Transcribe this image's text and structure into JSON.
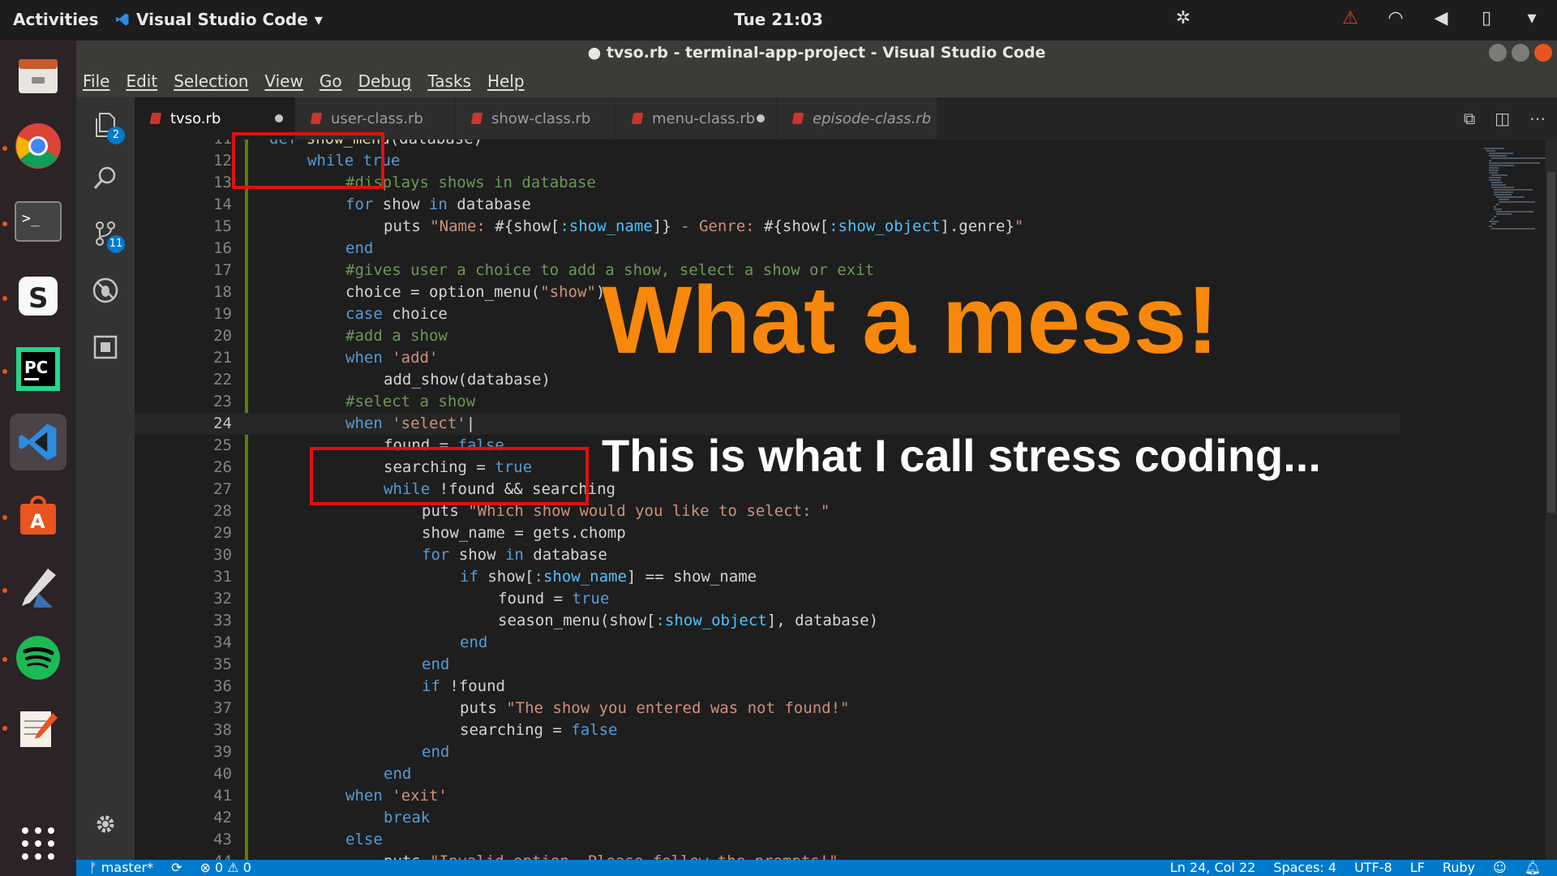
{
  "top_panel": {
    "activities": "Activities",
    "app_name": "Visual Studio Code",
    "clock": "Tue 21:03",
    "tray_icons": [
      "settings-icon",
      "warning-icon",
      "wifi-icon",
      "volume-icon",
      "battery-icon",
      "dropdown-icon"
    ]
  },
  "dock": {
    "apps": [
      "files-icon",
      "chrome-icon",
      "terminal-icon",
      "sublime-icon",
      "pycharm-icon",
      "vscode-icon",
      "software-center-icon",
      "inkscape-icon",
      "spotify-icon",
      "text-editor-icon",
      "app-grid-icon"
    ],
    "active_app": "vscode-icon"
  },
  "window": {
    "title": "● tvso.rb - terminal-app-project - Visual Studio Code"
  },
  "menu": [
    "File",
    "Edit",
    "Selection",
    "View",
    "Go",
    "Debug",
    "Tasks",
    "Help"
  ],
  "activity_bar": {
    "explorer_badge": "2",
    "scm_badge": "11"
  },
  "tabs": [
    {
      "label": "tvso.rb",
      "active": true,
      "dirty": true,
      "italic": false
    },
    {
      "label": "user-class.rb",
      "active": false,
      "dirty": false,
      "italic": false
    },
    {
      "label": "show-class.rb",
      "active": false,
      "dirty": false,
      "italic": false
    },
    {
      "label": "menu-class.rb",
      "active": false,
      "dirty": true,
      "italic": false
    },
    {
      "label": "episode-class.rb",
      "active": false,
      "dirty": false,
      "italic": true
    }
  ],
  "editor": {
    "current_line": 24,
    "lines": [
      {
        "n": "11",
        "indent": 0,
        "segments": [
          [
            "kw",
            "def "
          ],
          [
            "fn",
            "show_menu"
          ],
          [
            "",
            "(database)"
          ]
        ]
      },
      {
        "n": "12",
        "indent": 1,
        "segments": [
          [
            "kw",
            "while "
          ],
          [
            "kw",
            "true"
          ]
        ]
      },
      {
        "n": "13",
        "indent": 2,
        "segments": [
          [
            "cm",
            "#displays shows in database"
          ]
        ]
      },
      {
        "n": "14",
        "indent": 2,
        "segments": [
          [
            "kw",
            "for "
          ],
          [
            "",
            "show "
          ],
          [
            "kw",
            "in "
          ],
          [
            "",
            "database"
          ]
        ]
      },
      {
        "n": "15",
        "indent": 3,
        "segments": [
          [
            "",
            "puts "
          ],
          [
            "st",
            "\"Name: "
          ],
          [
            "",
            "#{show["
          ],
          [
            "sym",
            ":show_name"
          ],
          [
            "",
            "]} "
          ],
          [
            "st",
            "- Genre: "
          ],
          [
            "",
            "#{show["
          ],
          [
            "sym",
            ":show_object"
          ],
          [
            "",
            "].genre}"
          ],
          [
            "st",
            "\""
          ]
        ]
      },
      {
        "n": "16",
        "indent": 2,
        "segments": [
          [
            "kw",
            "end"
          ]
        ]
      },
      {
        "n": "17",
        "indent": 2,
        "segments": [
          [
            "cm",
            "#gives user a choice to add a show, select a show or exit"
          ]
        ]
      },
      {
        "n": "18",
        "indent": 2,
        "segments": [
          [
            "",
            "choice = option_menu("
          ],
          [
            "st",
            "\"show\""
          ],
          [
            "",
            ")"
          ]
        ]
      },
      {
        "n": "19",
        "indent": 2,
        "segments": [
          [
            "kw",
            "case "
          ],
          [
            "",
            "choice"
          ]
        ]
      },
      {
        "n": "20",
        "indent": 2,
        "segments": [
          [
            "cm",
            "#add a show"
          ]
        ]
      },
      {
        "n": "21",
        "indent": 2,
        "segments": [
          [
            "kw",
            "when "
          ],
          [
            "st",
            "'add'"
          ]
        ]
      },
      {
        "n": "22",
        "indent": 3,
        "segments": [
          [
            "",
            "add_show(database)"
          ]
        ]
      },
      {
        "n": "23",
        "indent": 2,
        "segments": [
          [
            "cm",
            "#select a show"
          ]
        ]
      },
      {
        "n": "24",
        "indent": 2,
        "segments": [
          [
            "kw",
            "when "
          ],
          [
            "st",
            "'select'"
          ],
          [
            "",
            "|"
          ]
        ]
      },
      {
        "n": "25",
        "indent": 3,
        "segments": [
          [
            "",
            "found = "
          ],
          [
            "kw",
            "false"
          ]
        ]
      },
      {
        "n": "26",
        "indent": 3,
        "segments": [
          [
            "",
            "searching = "
          ],
          [
            "kw",
            "true"
          ]
        ]
      },
      {
        "n": "27",
        "indent": 3,
        "segments": [
          [
            "kw",
            "while "
          ],
          [
            "",
            "!found && searching"
          ]
        ]
      },
      {
        "n": "28",
        "indent": 4,
        "segments": [
          [
            "",
            "puts "
          ],
          [
            "st",
            "\"Which show would you like to select: \""
          ]
        ]
      },
      {
        "n": "29",
        "indent": 4,
        "segments": [
          [
            "",
            "show_name = gets.chomp"
          ]
        ]
      },
      {
        "n": "30",
        "indent": 4,
        "segments": [
          [
            "kw",
            "for "
          ],
          [
            "",
            "show "
          ],
          [
            "kw",
            "in "
          ],
          [
            "",
            "database"
          ]
        ]
      },
      {
        "n": "31",
        "indent": 5,
        "segments": [
          [
            "kw",
            "if "
          ],
          [
            "",
            "show["
          ],
          [
            "sym",
            ":show_name"
          ],
          [
            "",
            "] == show_name"
          ]
        ]
      },
      {
        "n": "32",
        "indent": 6,
        "segments": [
          [
            "",
            "found = "
          ],
          [
            "kw",
            "true"
          ]
        ]
      },
      {
        "n": "33",
        "indent": 6,
        "segments": [
          [
            "",
            "season_menu(show["
          ],
          [
            "sym",
            ":show_object"
          ],
          [
            "",
            "], database)"
          ]
        ]
      },
      {
        "n": "34",
        "indent": 5,
        "segments": [
          [
            "kw",
            "end"
          ]
        ]
      },
      {
        "n": "35",
        "indent": 4,
        "segments": [
          [
            "kw",
            "end"
          ]
        ]
      },
      {
        "n": "36",
        "indent": 4,
        "segments": [
          [
            "kw",
            "if "
          ],
          [
            "",
            "!found"
          ]
        ]
      },
      {
        "n": "37",
        "indent": 5,
        "segments": [
          [
            "",
            "puts "
          ],
          [
            "st",
            "\"The show you entered was not found!\""
          ]
        ]
      },
      {
        "n": "38",
        "indent": 5,
        "segments": [
          [
            "",
            "searching = "
          ],
          [
            "kw",
            "false"
          ]
        ]
      },
      {
        "n": "39",
        "indent": 4,
        "segments": [
          [
            "kw",
            "end"
          ]
        ]
      },
      {
        "n": "40",
        "indent": 3,
        "segments": [
          [
            "kw",
            "end"
          ]
        ]
      },
      {
        "n": "41",
        "indent": 2,
        "segments": [
          [
            "kw",
            "when "
          ],
          [
            "st",
            "'exit'"
          ]
        ]
      },
      {
        "n": "42",
        "indent": 3,
        "segments": [
          [
            "kw",
            "break"
          ]
        ]
      },
      {
        "n": "43",
        "indent": 2,
        "segments": [
          [
            "kw",
            "else"
          ]
        ]
      },
      {
        "n": "44",
        "indent": 3,
        "segments": [
          [
            "",
            "puts "
          ],
          [
            "st",
            "\"Invalid option. Please follow the prompts!\""
          ]
        ]
      }
    ]
  },
  "status_bar": {
    "branch": "master*",
    "sync": "⟳",
    "errors": "⊗ 0",
    "warnings": "⚠ 0",
    "position": "Ln 24, Col 22",
    "spaces": "Spaces: 4",
    "encoding": "UTF-8",
    "eol": "LF",
    "language": "Ruby",
    "feedback_icon": "smiley-icon",
    "bell_icon": "bell-icon"
  },
  "overlay": {
    "headline": "What a mess!",
    "subtitle": "This is what I call stress coding...",
    "headline_color": "#f7880b",
    "box_color": "#e01010"
  }
}
